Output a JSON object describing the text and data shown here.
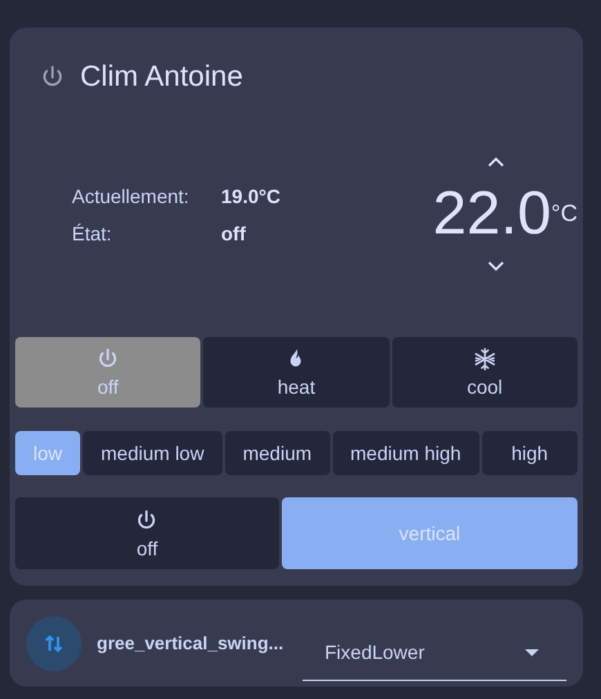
{
  "climate": {
    "title": "Clim Antoine",
    "current_label": "Actuellement:",
    "current_value": "19.0°C",
    "state_label": "État:",
    "state_value": "off",
    "target": "22.0",
    "unit": "°C",
    "modes": [
      {
        "kind": "off",
        "label": "off",
        "selected": true
      },
      {
        "kind": "heat",
        "label": "heat",
        "selected": false
      },
      {
        "kind": "cool",
        "label": "cool",
        "selected": false
      }
    ],
    "fan_speeds": [
      {
        "label": "low",
        "selected": true
      },
      {
        "label": "medium low",
        "selected": false
      },
      {
        "label": "medium",
        "selected": false
      },
      {
        "label": "medium high",
        "selected": false
      },
      {
        "label": "high",
        "selected": false
      }
    ],
    "swing_modes": [
      {
        "kind": "off",
        "label": "off",
        "selected": false
      },
      {
        "kind": "vertical",
        "label": "vertical",
        "selected": true
      }
    ]
  },
  "select_entity": {
    "name": "gree_vertical_swing...",
    "value": "FixedLower"
  }
}
